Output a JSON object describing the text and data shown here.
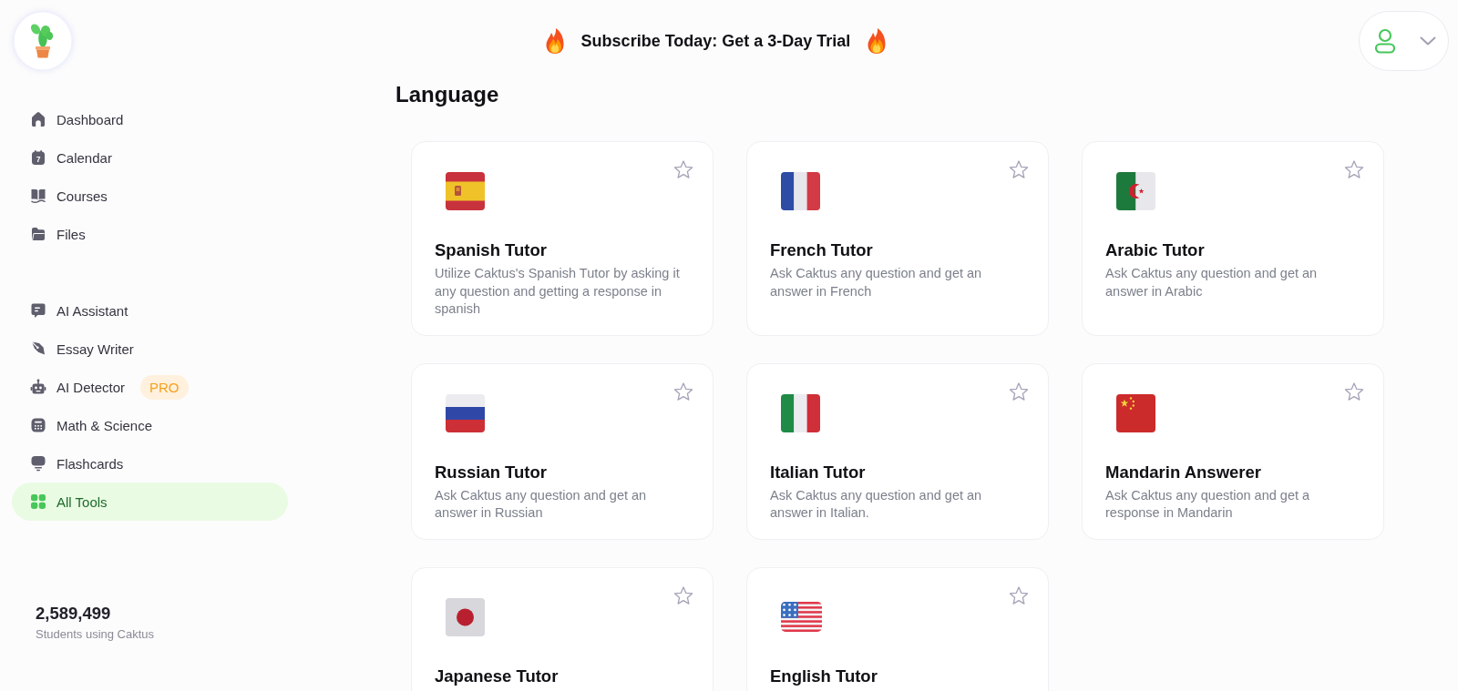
{
  "header": {
    "banner": "Subscribe Today: Get a 3-Day Trial"
  },
  "sidebar": {
    "primary": [
      {
        "label": "Dashboard",
        "selected": false
      },
      {
        "label": "Calendar",
        "icon_text": "7",
        "selected": false
      },
      {
        "label": "Courses",
        "selected": false
      },
      {
        "label": "Files",
        "selected": false
      }
    ],
    "tools": [
      {
        "label": "AI Assistant",
        "selected": false
      },
      {
        "label": "Essay Writer",
        "selected": false
      },
      {
        "label": "AI Detector",
        "badge": "PRO",
        "selected": false
      },
      {
        "label": "Math & Science",
        "selected": false
      },
      {
        "label": "Flashcards",
        "selected": false
      },
      {
        "label": "All Tools",
        "selected": true
      }
    ],
    "stats": {
      "count": "2,589,499",
      "caption": "Students using Caktus"
    }
  },
  "section": {
    "title": "Language",
    "cards": [
      {
        "title": "Spanish Tutor",
        "description": "Utilize Caktus's Spanish Tutor by asking it any question and getting a response in spanish",
        "favorited": false
      },
      {
        "title": "French Tutor",
        "description": "Ask Caktus any question and get an answer in French",
        "favorited": false
      },
      {
        "title": "Arabic Tutor",
        "description": "Ask Caktus any question and get an answer in Arabic",
        "favorited": false
      },
      {
        "title": "Russian Tutor",
        "description": "Ask Caktus any question and get an answer in Russian",
        "favorited": false
      },
      {
        "title": "Italian Tutor",
        "description": "Ask Caktus any question and get an answer in Italian.",
        "favorited": false
      },
      {
        "title": "Mandarin Answerer",
        "description": "Ask Caktus any question and get a response in Mandarin",
        "favorited": false
      },
      {
        "title": "Japanese Tutor",
        "favorited": false
      },
      {
        "title": "English Tutor",
        "favorited": false
      }
    ]
  }
}
